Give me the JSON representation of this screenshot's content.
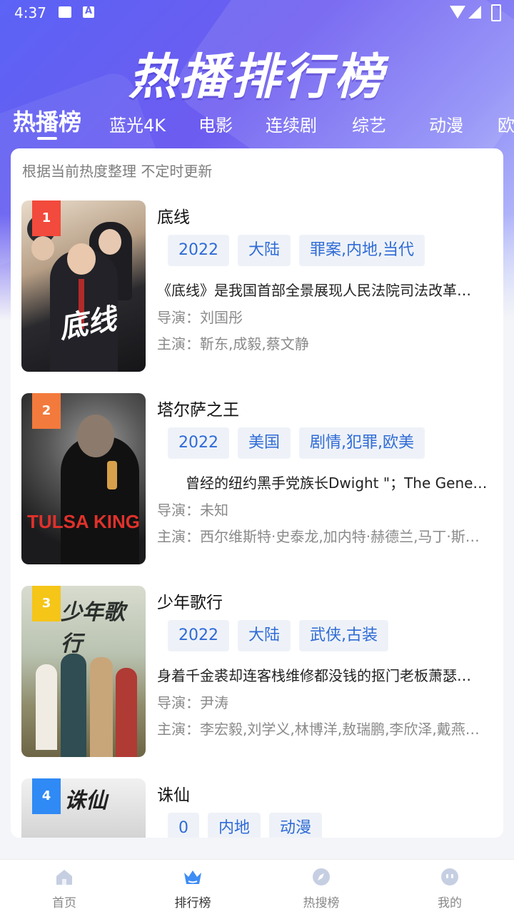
{
  "status_bar": {
    "time": "4:37"
  },
  "header": {
    "title": "热播排行榜"
  },
  "tabs": [
    {
      "label": "热播榜",
      "active": true
    },
    {
      "label": "蓝光4K"
    },
    {
      "label": "电影"
    },
    {
      "label": "连续剧"
    },
    {
      "label": "综艺"
    },
    {
      "label": "动漫"
    },
    {
      "label": "欧"
    }
  ],
  "card": {
    "subtitle": "根据当前热度整理 不定时更新"
  },
  "items": [
    {
      "rank": "1",
      "title": "底线",
      "tags": [
        "2022",
        "大陆",
        "罪案,内地,当代"
      ],
      "description": "《底线》是我国首部全景展现人民法院司法改革…",
      "director": "导演：刘国彤",
      "actors": "主演：靳东,成毅,蔡文静",
      "poster_text": "底线",
      "rank_color": "#f24a3c"
    },
    {
      "rank": "2",
      "title": "塔尔萨之王",
      "tags": [
        "2022",
        "美国",
        "剧情,犯罪,欧美"
      ],
      "description": "　　曾经的纽约黑手党族长Dwight \"；The Gener…",
      "director": "导演：未知",
      "actors": "主演：西尔维斯特·史泰龙,加内特·赫德兰,马丁·斯…",
      "poster_text": "TULSA KING",
      "rank_color": "#f27a3c"
    },
    {
      "rank": "3",
      "title": "少年歌行",
      "tags": [
        "2022",
        "大陆",
        "武侠,古装"
      ],
      "description": "身着千金裘却连客栈维修都没钱的抠门老板萧瑟…",
      "director": "导演：尹涛",
      "actors": "主演：李宏毅,刘学义,林博洋,敖瑞鹏,李欣泽,戴燕…",
      "poster_text": "少年歌行",
      "rank_color": "#f5c518"
    },
    {
      "rank": "4",
      "title": "诛仙",
      "tags": [
        "0",
        "内地",
        "动漫"
      ],
      "description": "",
      "director": "",
      "actors": "",
      "poster_text": "诛仙",
      "rank_color": "#2f8af5"
    }
  ],
  "bottom_nav": [
    {
      "label": "首页",
      "icon": "home-icon"
    },
    {
      "label": "排行榜",
      "icon": "crown-icon",
      "active": true
    },
    {
      "label": "热搜榜",
      "icon": "compass-icon"
    },
    {
      "label": "我的",
      "icon": "profile-icon"
    }
  ],
  "colors": {
    "accent": "#2f6bd6",
    "hero_start": "#5b63f5",
    "hero_end": "#c8d2fb"
  }
}
